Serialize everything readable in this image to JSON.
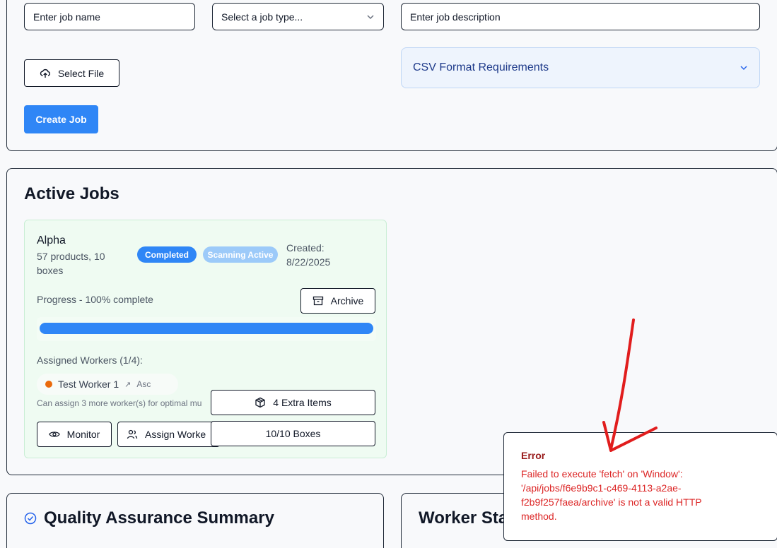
{
  "form": {
    "job_name_placeholder": "Enter job name",
    "job_type_placeholder": "Select a job type...",
    "job_description_placeholder": "Enter job description",
    "select_file_label": "Select File",
    "csv_requirements_label": "CSV Format Requirements",
    "create_job_label": "Create Job"
  },
  "active_jobs": {
    "title": "Active Jobs",
    "job": {
      "name": "Alpha",
      "summary": "57 products, 10 boxes",
      "status_badge": "Completed",
      "scanning_badge": "Scanning Active",
      "created_label": "Created:",
      "created_date": "8/22/2025",
      "progress_label": "Progress - 100% complete",
      "progress_fraction": 1.0,
      "archive_label": "Archive",
      "workers_label": "Assigned Workers (1/4):",
      "worker_name": "Test Worker 1",
      "worker_tag": "Asc",
      "assign_hint": "Can assign 3 more worker(s) for optimal mu",
      "extra_items_label": "4 Extra Items",
      "monitor_label": "Monitor",
      "assign_label": "Assign Worke",
      "boxes_label": "10/10 Boxes"
    }
  },
  "qa_summary": {
    "title": "Quality Assurance Summary"
  },
  "worker_stats": {
    "title": "Worker Sta"
  },
  "error_toast": {
    "title": "Error",
    "message": "Failed to execute 'fetch' on 'Window': '/api/jobs/f6e9b9c1-c469-4113-a2ae-f2b9f257faea/archive' is not a valid HTTP method."
  },
  "colors": {
    "primary": "#2f86f6",
    "success_bg": "#effbf2",
    "error_text": "#dc2626",
    "annotation_arrow": "#e11d1d"
  }
}
